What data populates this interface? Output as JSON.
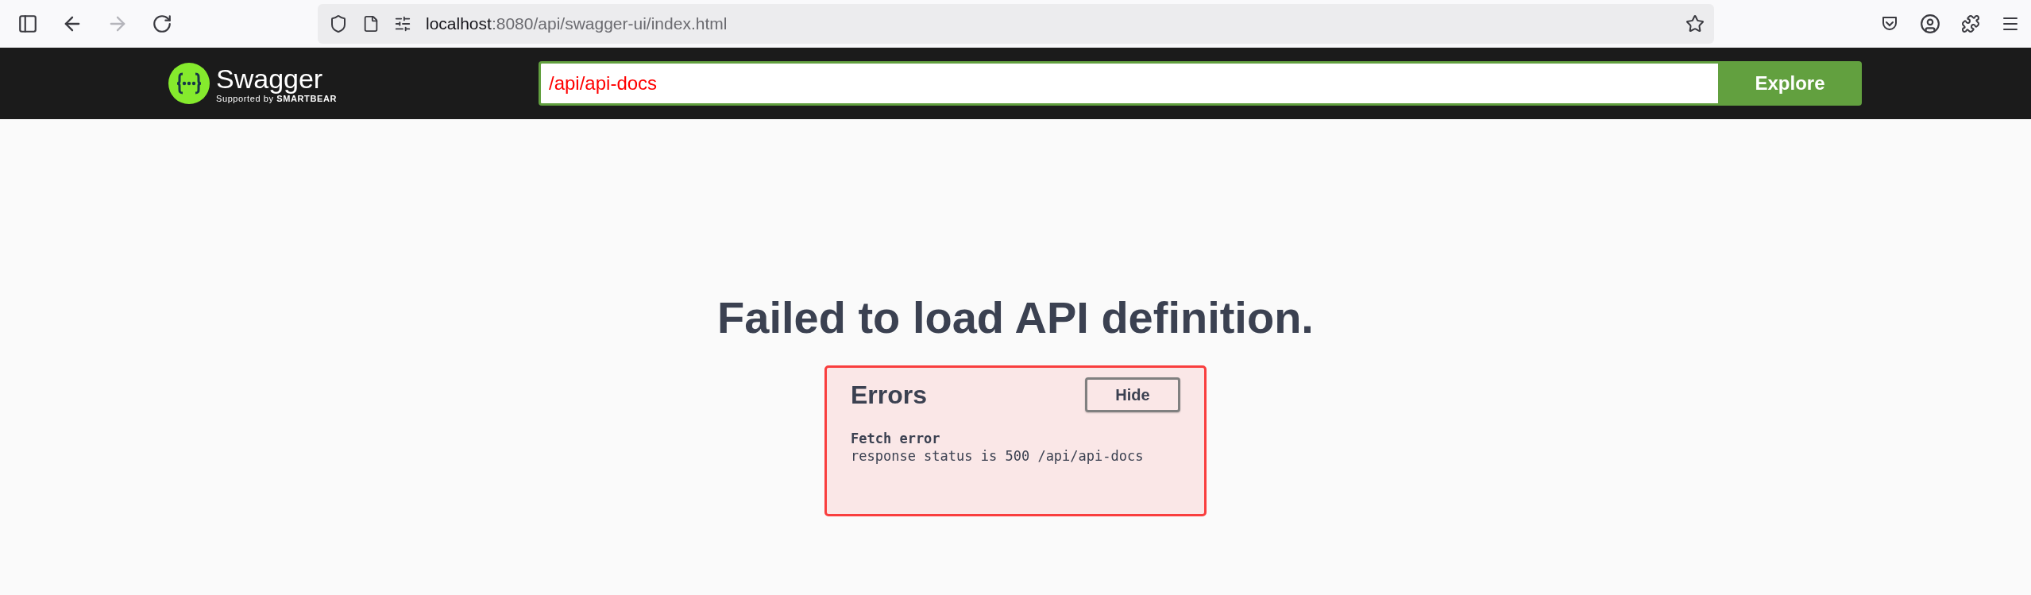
{
  "browser": {
    "nav": [
      {
        "kind": "sidebar",
        "disabled": false
      },
      {
        "kind": "back",
        "disabled": false
      },
      {
        "kind": "forward",
        "disabled": true
      },
      {
        "kind": "reload",
        "disabled": false
      }
    ],
    "address": {
      "host": "localhost",
      "path": ":8080/api/swagger-ui/index.html"
    }
  },
  "header": {
    "logo": {
      "name": "Swagger",
      "tagline_prefix": "Supported by",
      "tagline_brand": "SMARTBEAR"
    },
    "url_field": {
      "value": "/api/api-docs"
    },
    "explore_button": "Explore"
  },
  "main": {
    "title": "Failed to load API definition.",
    "errors": {
      "title": "Errors",
      "hide_button": "Hide",
      "items": [
        {
          "heading": "Fetch error",
          "message": "response status is 500 /api/api-docs"
        }
      ]
    }
  }
}
